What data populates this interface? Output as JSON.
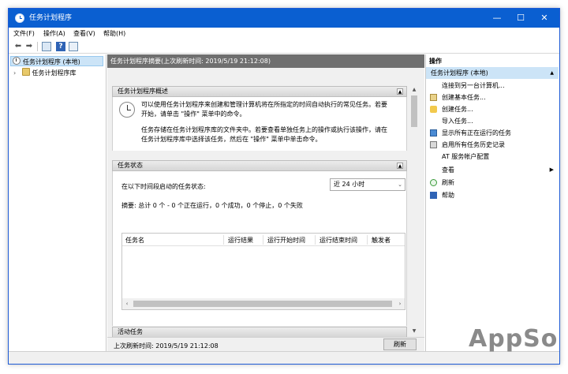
{
  "window": {
    "title": "任务计划程序",
    "controls": {
      "minimize": "—",
      "maximize": "☐",
      "close": "✕"
    }
  },
  "menu": [
    "文件(F)",
    "操作(A)",
    "查看(V)",
    "帮助(H)"
  ],
  "toolbar": {
    "back_glyph": "⬅",
    "forward_glyph": "➡",
    "help_glyph": "?"
  },
  "tree": {
    "root_label": "任务计划程序 (本地)",
    "child_label": "任务计划程序库",
    "child_expander": "›"
  },
  "center": {
    "header": "任务计划程序摘要(上次刷新时间: 2019/5/19 21:12:08)",
    "overview": {
      "title": "任务计划程序概述",
      "para1_line1": "可以使用任务计划程序来创建和管理计算机将在所指定的时间自动执行的常见任务。若要",
      "para1_line2": "开始，请单击 \"操作\" 菜单中的命令。",
      "para2_line1": "任务存储在任务计划程序库的文件夹中。若要查看单独任务上的操作或执行该操作，请在",
      "para2_line2": "任务计划程序库中选择该任务，然后在 \"操作\" 菜单中单击命令。"
    },
    "status": {
      "title": "任务状态",
      "label": "在以下时间段启动的任务状态:",
      "dropdown_value": "近 24 小时",
      "summary": "摘要: 总计 0 个 - 0 个正在运行，0 个成功，0 个停止，0 个失败",
      "columns": [
        "任务名",
        "运行结果",
        "运行开始时间",
        "运行结束时间",
        "触发者"
      ]
    },
    "active": {
      "title": "活动任务"
    },
    "footer": {
      "last_refresh": "上次刷新时间: 2019/5/19 21:12:08",
      "refresh_button": "刷新"
    }
  },
  "actions": {
    "title": "操作",
    "group_label": "任务计划程序 (本地)",
    "items": [
      "连接到另一台计算机...",
      "创建基本任务...",
      "创建任务...",
      "导入任务...",
      "显示所有正在运行的任务",
      "启用所有任务历史记录",
      "AT 服务帐户配置",
      "查看",
      "刷新",
      "帮助"
    ]
  },
  "watermark": "AppSo",
  "colors": {
    "titlebar": "#0a5fd1",
    "selection": "#cce4f7",
    "header_band": "#6f6f6f"
  }
}
